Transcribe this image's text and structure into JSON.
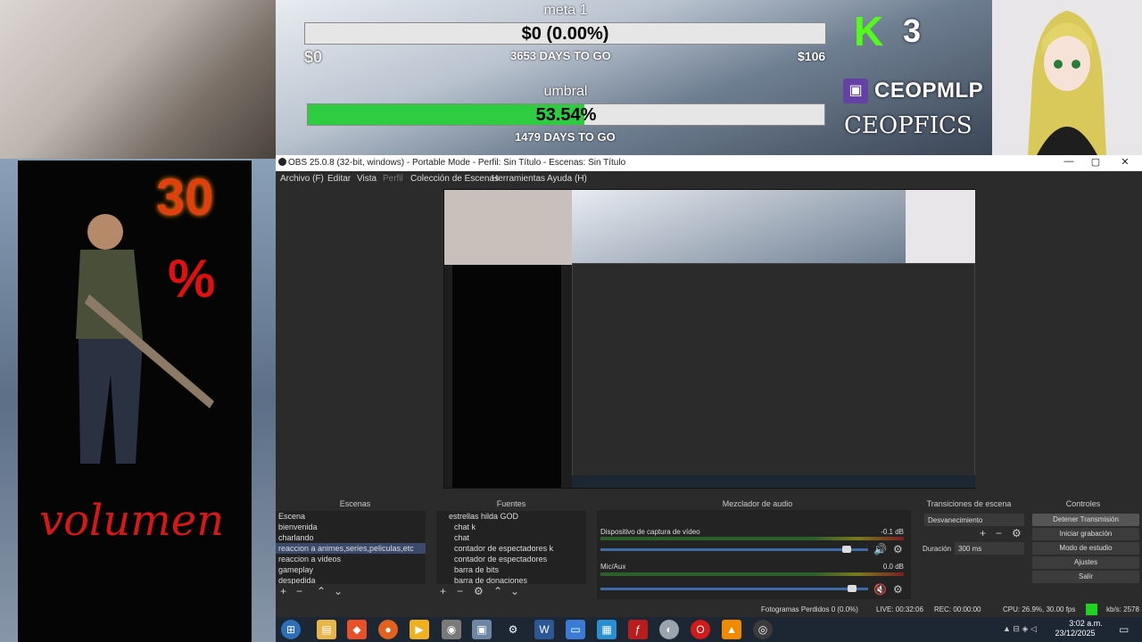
{
  "overlay": {
    "goal1": {
      "name": "meta 1",
      "bar_text": "$0 (0.00%)",
      "left": "$0",
      "right": "$106",
      "days": "3653 DAYS TO GO",
      "progress": 0.0
    },
    "goal2": {
      "name": "umbral",
      "bar_text": "53.54%",
      "days": "1479 DAYS TO GO",
      "progress": 0.5354
    },
    "kick_count": "3",
    "twitch_name": "CEOPMLP",
    "channel_name": "CEOPFICS",
    "poster": {
      "number": "30",
      "percent": "%",
      "word": "volumen"
    }
  },
  "obs": {
    "title": "OBS 25.0.8 (32-bit, windows) - Portable Mode - Perfil: Sin Título - Escenas: Sin Título",
    "menu": [
      "Archivo (F)",
      "Editar",
      "Vista",
      "Perfil",
      "Colección de Escenas",
      "Herramientas",
      "Ayuda (H)"
    ],
    "docks": {
      "scenes": "Escenas",
      "sources": "Fuentes",
      "mixer": "Mezclador de audio",
      "transitions": "Transiciones de escena",
      "controls": "Controles"
    },
    "scenes": [
      "Escena",
      "bienvenida",
      "charlando",
      "reaccion a animes,series,peliculas,etc",
      "reaccion a videos",
      "gameplay",
      "despedida"
    ],
    "selected_scene": 3,
    "sources": [
      "estrellas hilda GOD",
      "chat k",
      "chat",
      "contador de espectadores k",
      "contador de espectadores",
      "barra de bits",
      "barra de donaciones"
    ],
    "mixer": [
      {
        "name": "Dispositivo de captura de vídeo",
        "db": "-0.1 dB",
        "level": 0.92
      },
      {
        "name": "Mic/Aux",
        "db": "0.0 dB",
        "level": 0.94
      }
    ],
    "transition": {
      "type": "Desvanecimiento",
      "duration_label": "Duración",
      "duration": "300 ms"
    },
    "controls": [
      "Detener Transmisión",
      "Iniciar grabación",
      "Modo de estudio",
      "Ajustes",
      "Salir"
    ],
    "status": {
      "dropped": "Fotogramas Perdidos 0 (0.0%)",
      "live": "LIVE: 00:32:06",
      "rec": "REC: 00:00:00",
      "cpu": "CPU: 26.9%, 30.00 fps",
      "kbps": "kb/s: 2578"
    }
  },
  "taskbar": {
    "time": "3:02 a.m.",
    "date": "23/12/2025",
    "icons": [
      "start-icon",
      "file-explorer-icon",
      "brave-icon",
      "firefox-icon",
      "media-player-icon",
      "app-icon",
      "app-icon-2",
      "settings-icon",
      "word-icon",
      "monitor-icon",
      "remote-desktop-icon",
      "flash-icon",
      "app-icon-3",
      "opera-icon",
      "vlc-icon",
      "obs-icon"
    ]
  }
}
